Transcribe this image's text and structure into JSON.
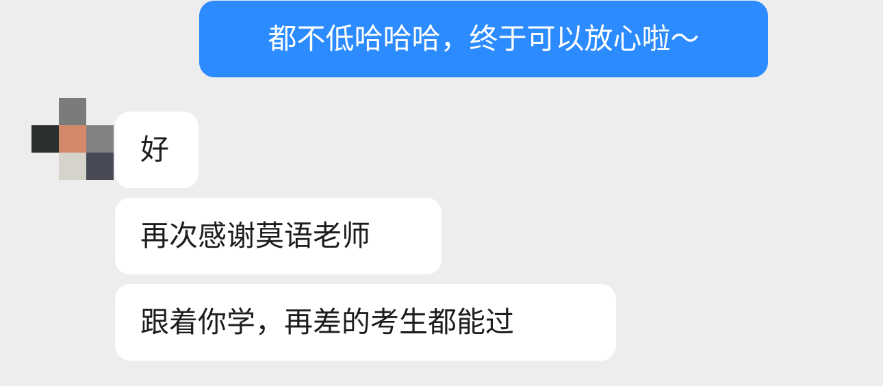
{
  "chat": {
    "messages": [
      {
        "id": "msg-0",
        "side": "sent",
        "text": "都不低哈哈哈，终于可以放心啦～"
      },
      {
        "id": "msg-1",
        "side": "received",
        "text": "好"
      },
      {
        "id": "msg-2",
        "side": "received",
        "text": "再次感谢莫语老师"
      },
      {
        "id": "msg-3",
        "side": "received",
        "text": "跟着你学，再差的考生都能过"
      }
    ],
    "avatar": {
      "pixels": [
        "#7a7b7b",
        "#2b2f30",
        "#d4896c",
        "#828180",
        "#d6d3ca",
        "#474a54"
      ]
    }
  },
  "colors": {
    "background": "#ededed",
    "sent_bubble": "#2b8bff",
    "received_bubble": "#ffffff"
  }
}
